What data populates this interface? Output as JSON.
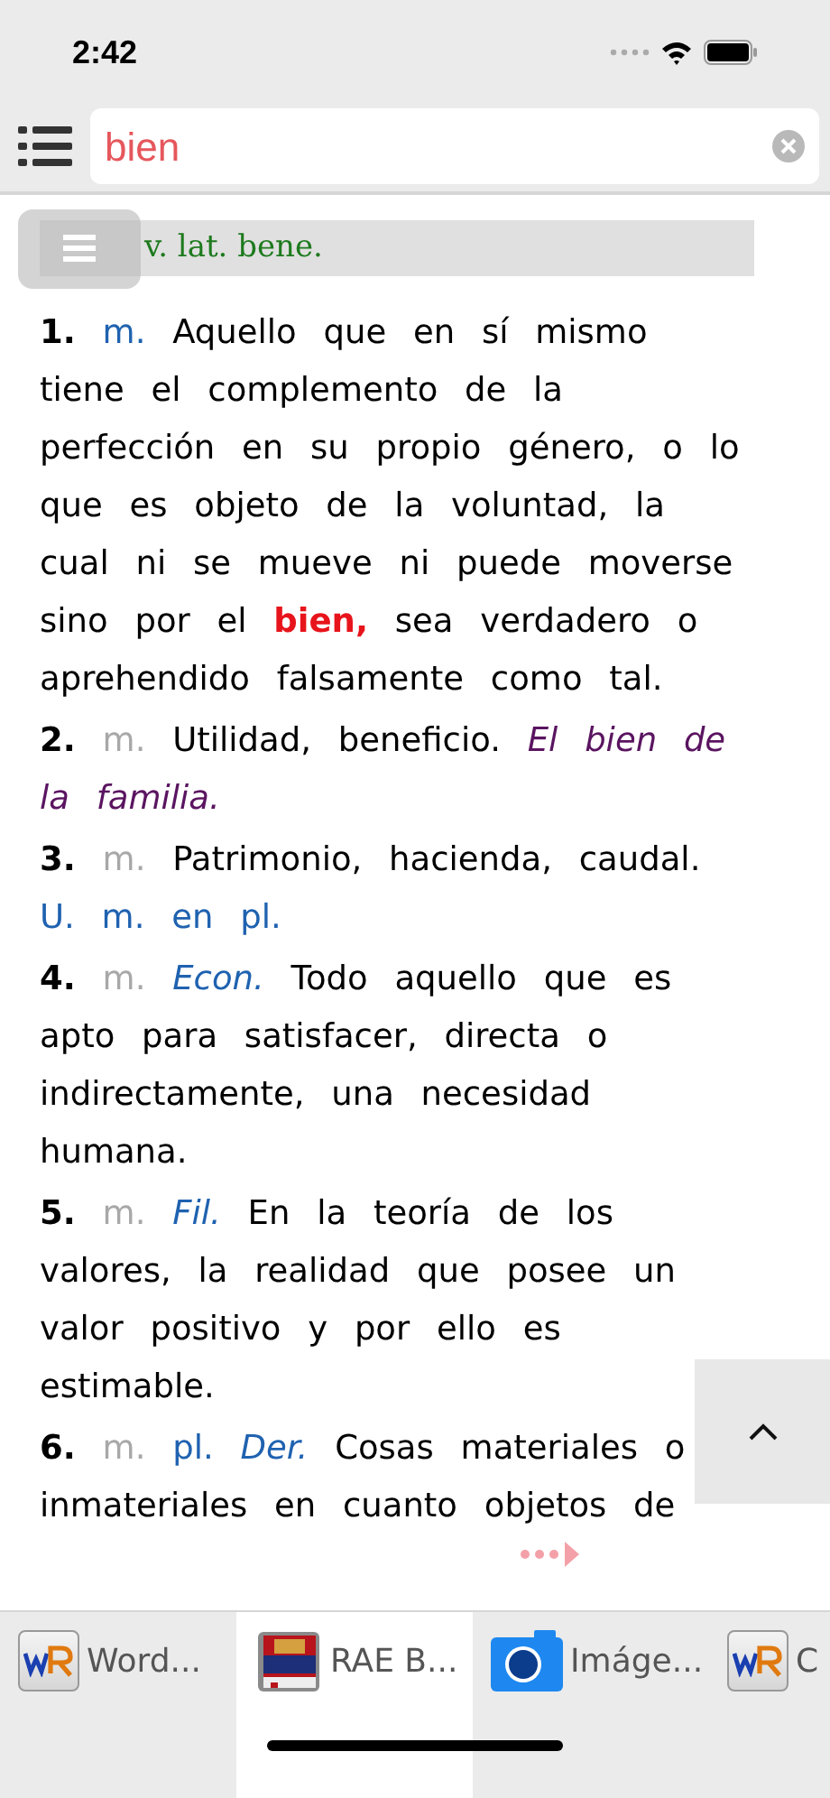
{
  "status_bar": {
    "time": "2:42"
  },
  "search": {
    "value": "bien"
  },
  "etymology": "v. lat. bene.",
  "senses": [
    {
      "number": "1.",
      "segments": [
        {
          "kind": "abbr-blue",
          "text": "m."
        },
        {
          "kind": "text",
          "text": "Aquello que en sí mismo tiene el complemento de la perfección en su propio género, o lo que es objeto de la voluntad, la cual ni se mueve ni puede moverse sino por el"
        },
        {
          "kind": "highlight",
          "text": "bien,"
        },
        {
          "kind": "text",
          "text": "sea verdadero o aprehendido falsamente como tal."
        }
      ]
    },
    {
      "number": "2.",
      "segments": [
        {
          "kind": "abbr-gray",
          "text": "m."
        },
        {
          "kind": "text",
          "text": "Utilidad, beneficio."
        },
        {
          "kind": "example",
          "text": "El bien de la familia."
        }
      ]
    },
    {
      "number": "3.",
      "segments": [
        {
          "kind": "abbr-gray",
          "text": "m."
        },
        {
          "kind": "text",
          "text": "Patrimonio, hacienda, caudal."
        },
        {
          "kind": "usage",
          "text": "U. m. en pl."
        }
      ]
    },
    {
      "number": "4.",
      "segments": [
        {
          "kind": "abbr-gray",
          "text": "m."
        },
        {
          "kind": "field",
          "text": "Econ."
        },
        {
          "kind": "text",
          "text": "Todo aquello que es apto para satisfacer, directa o indirectamente, una necesidad humana."
        }
      ]
    },
    {
      "number": "5.",
      "segments": [
        {
          "kind": "abbr-gray",
          "text": "m."
        },
        {
          "kind": "field",
          "text": "Fil."
        },
        {
          "kind": "text",
          "text": "En la teoría de los valores, la realidad que posee un valor positivo y por ello es estimable."
        }
      ]
    },
    {
      "number": "6.",
      "segments": [
        {
          "kind": "abbr-gray",
          "text": "m."
        },
        {
          "kind": "usage",
          "text": "pl."
        },
        {
          "kind": "field",
          "text": "Der."
        },
        {
          "kind": "text",
          "text": "Cosas materiales o inmateriales en cuanto objetos de"
        }
      ]
    }
  ],
  "tabs": [
    {
      "label": "Word...",
      "kind": "wr",
      "selected": false
    },
    {
      "label": "RAE B...",
      "kind": "book",
      "selected": true
    },
    {
      "label": "Imáge...",
      "kind": "camera",
      "selected": false
    },
    {
      "label": "C",
      "kind": "wr",
      "selected": false
    }
  ]
}
